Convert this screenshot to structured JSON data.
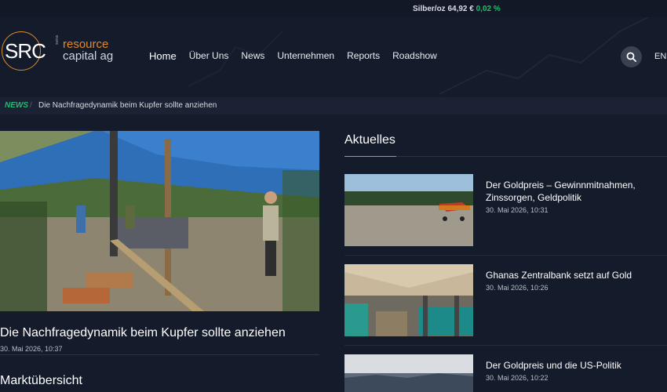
{
  "ticker": {
    "label": "Silber/oz 64,92 €",
    "change": "0,02 %",
    "change_color": "#19c26b"
  },
  "logo": {
    "abbr": "SRC",
    "small": "swiss",
    "line1": "resource",
    "line2": "capital ag",
    "accent": "#e08a2a"
  },
  "nav": {
    "items": [
      {
        "label": "Home"
      },
      {
        "label": "Über Uns"
      },
      {
        "label": "News"
      },
      {
        "label": "Unternehmen"
      },
      {
        "label": "Reports"
      },
      {
        "label": "Roadshow"
      }
    ],
    "search_icon": "search-icon",
    "lang": "EN"
  },
  "breadcrumb": {
    "section": "NEWS",
    "separator": "/",
    "current": "Die Nachfragedynamik beim Kupfer sollte anziehen"
  },
  "hero": {
    "title": "Die Nachfragedynamik beim Kupfer sollte anziehen",
    "date": "30. Mai 2026, 10:37"
  },
  "markt": {
    "title": "Marktübersicht"
  },
  "aktuelles": {
    "title": "Aktuelles",
    "items": [
      {
        "title": "Der Goldpreis – Gewinnmitnahmen, Zinssorgen, Geldpolitik",
        "date": "30. Mai 2026, 10:31"
      },
      {
        "title": "Ghanas Zentralbank setzt auf Gold",
        "date": "30. Mai 2026, 10:26"
      },
      {
        "title": "Der Goldpreis und die US-Politik",
        "date": "30. Mai 2026, 10:22"
      }
    ]
  }
}
